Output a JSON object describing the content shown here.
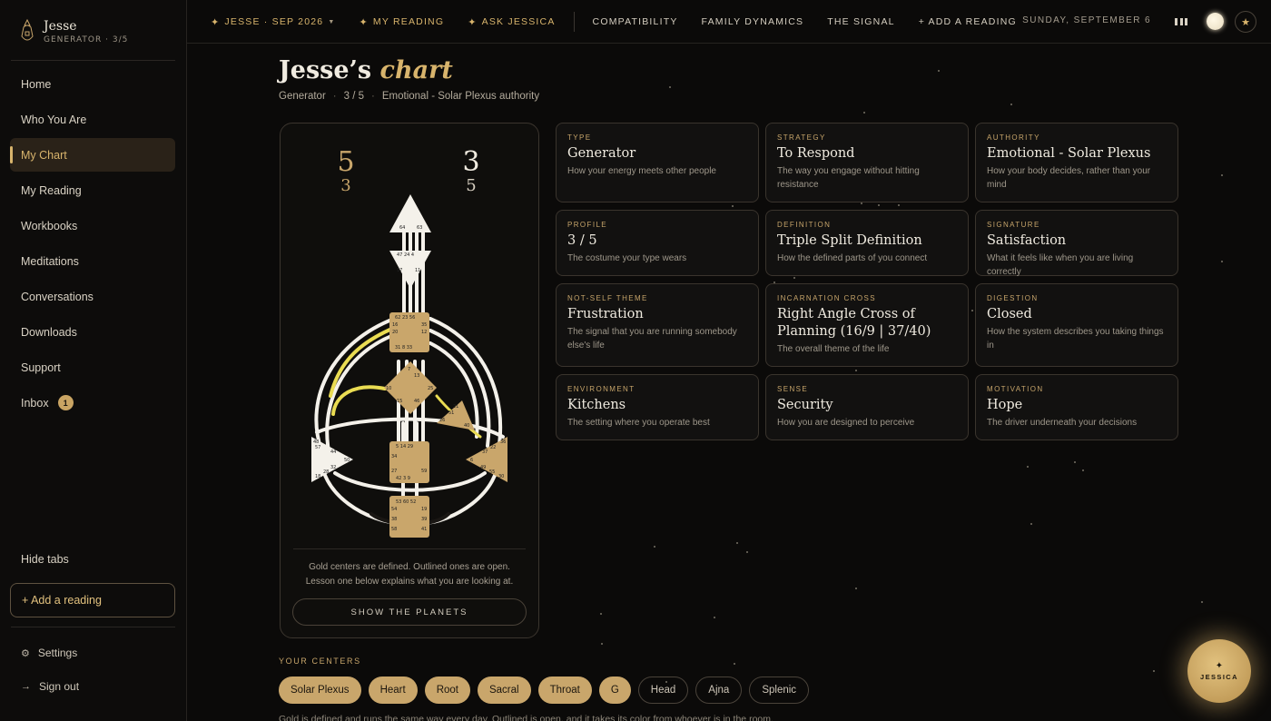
{
  "brand": {
    "name": "Jesse",
    "subtitle": "GENERATOR · 3/5"
  },
  "sidebar": {
    "items": [
      {
        "label": "Home",
        "active": false
      },
      {
        "label": "Who You Are",
        "active": false
      },
      {
        "label": "My Chart",
        "active": true
      },
      {
        "label": "My Reading",
        "active": false
      },
      {
        "label": "Workbooks",
        "active": false
      },
      {
        "label": "Meditations",
        "active": false
      },
      {
        "label": "Conversations",
        "active": false
      },
      {
        "label": "Downloads",
        "active": false
      },
      {
        "label": "Support",
        "active": false
      },
      {
        "label": "Inbox",
        "active": false,
        "badge": "1"
      }
    ],
    "hide_tabs": "Hide tabs",
    "add_reading": "+ Add a reading",
    "settings": "Settings",
    "sign_out": "Sign out"
  },
  "topbar": {
    "profile_menu": "JESSE · SEP 2026",
    "my_reading": "MY READING",
    "ask_jessica": "ASK JESSICA",
    "compatibility": "COMPATIBILITY",
    "family_dynamics": "FAMILY DYNAMICS",
    "the_signal": "THE SIGNAL",
    "add_reading": "+ ADD A READING",
    "date": "SUNDAY, SEPTEMBER 6"
  },
  "page": {
    "title_name": "Jesse’s",
    "title_word": "chart",
    "sub_type": "Generator",
    "sub_profile": "3 / 5",
    "sub_authority": "Emotional - Solar Plexus authority"
  },
  "chart": {
    "personality_top": "5",
    "personality_bottom": "3",
    "design_top": "3",
    "design_bottom": "5",
    "note": "Gold centers are defined. Outlined ones are open. Lesson one below explains what you are looking at.",
    "show_planets": "SHOW THE PLANETS"
  },
  "cards": [
    {
      "label": "TYPE",
      "value": "Generator",
      "desc": "How your energy meets other people"
    },
    {
      "label": "STRATEGY",
      "value": "To Respond",
      "desc": "The way you engage without hitting resistance"
    },
    {
      "label": "AUTHORITY",
      "value": "Emotional - Solar Plexus",
      "desc": "How your body decides, rather than your mind"
    },
    {
      "label": "PROFILE",
      "value": "3 / 5",
      "desc": "The costume your type wears"
    },
    {
      "label": "DEFINITION",
      "value": "Triple Split Definition",
      "desc": "How the defined parts of you connect"
    },
    {
      "label": "SIGNATURE",
      "value": "Satisfaction",
      "desc": "What it feels like when you are living correctly"
    },
    {
      "label": "NOT-SELF THEME",
      "value": "Frustration",
      "desc": "The signal that you are running somebody else's life"
    },
    {
      "label": "INCARNATION CROSS",
      "value": "Right Angle Cross of Planning (16/9 | 37/40)",
      "desc": "The overall theme of the life"
    },
    {
      "label": "DIGESTION",
      "value": "Closed",
      "desc": "How the system describes you taking things in"
    },
    {
      "label": "ENVIRONMENT",
      "value": "Kitchens",
      "desc": "The setting where you operate best"
    },
    {
      "label": "SENSE",
      "value": "Security",
      "desc": "How you are designed to perceive"
    },
    {
      "label": "MOTIVATION",
      "value": "Hope",
      "desc": "The driver underneath your decisions"
    }
  ],
  "centers": {
    "label": "YOUR CENTERS",
    "chips": [
      {
        "name": "Solar Plexus",
        "defined": true
      },
      {
        "name": "Heart",
        "defined": true
      },
      {
        "name": "Root",
        "defined": true
      },
      {
        "name": "Sacral",
        "defined": true
      },
      {
        "name": "Throat",
        "defined": true
      },
      {
        "name": "G",
        "defined": true
      },
      {
        "name": "Head",
        "defined": false
      },
      {
        "name": "Ajna",
        "defined": false
      },
      {
        "name": "Splenic",
        "defined": false
      }
    ],
    "footnote": "Gold is defined and runs the same way every day. Outlined is open, and it takes its color from whoever is in the room."
  },
  "jessica": {
    "label": "JESSICA"
  },
  "colors": {
    "gold": "#c9a66b",
    "accent": "#d8b46c",
    "background": "#0b0a09"
  }
}
